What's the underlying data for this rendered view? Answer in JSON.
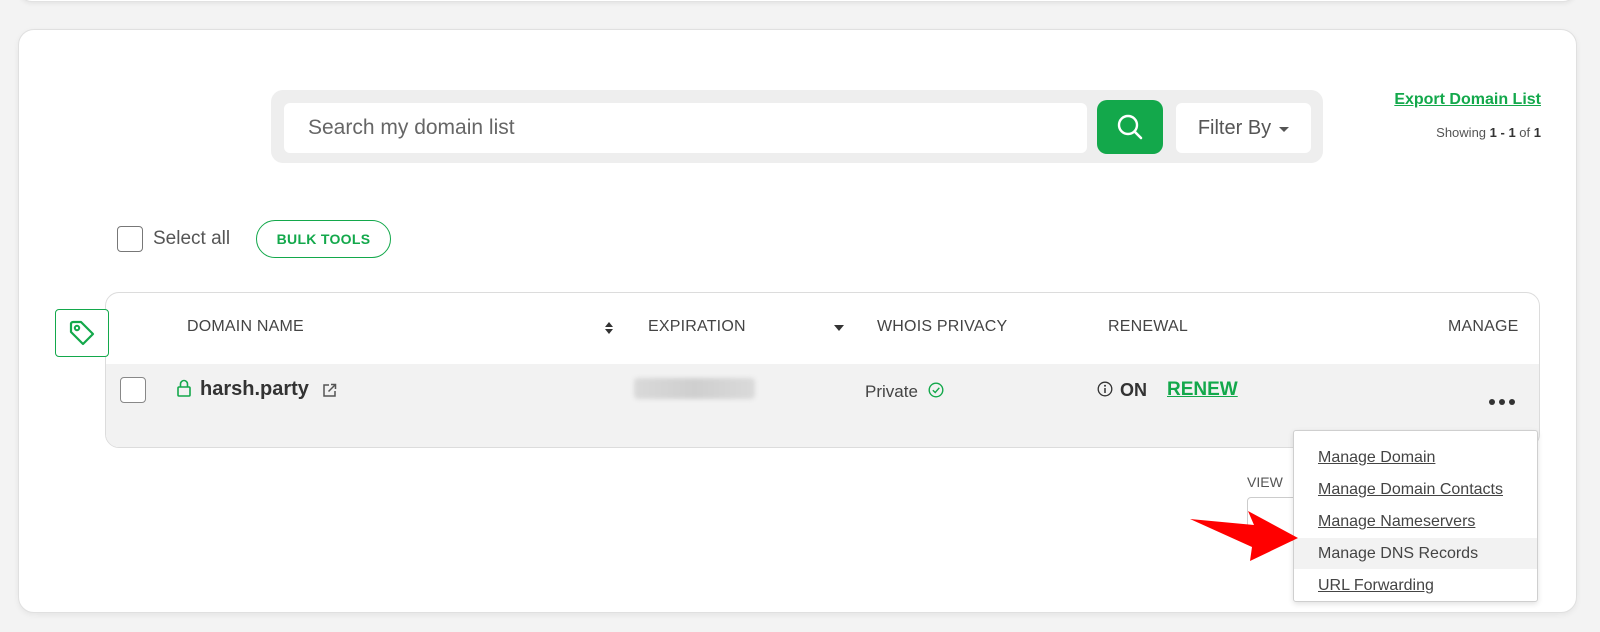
{
  "search": {
    "placeholder": "Search my domain list",
    "filter_label": "Filter By"
  },
  "header_links": {
    "export_label": "Export Domain List",
    "showing_prefix": "Showing",
    "showing_range": "1 - 1",
    "showing_of": "of",
    "showing_total": "1"
  },
  "bulk": {
    "select_all_label": "Select all",
    "bulk_tools_label": "BULK TOOLS"
  },
  "table": {
    "columns": [
      "DOMAIN NAME",
      "EXPIRATION",
      "WHOIS PRIVACY",
      "RENEWAL",
      "MANAGE"
    ],
    "rows": [
      {
        "domain": "harsh.party",
        "whois": "Private",
        "renewal_status": "ON",
        "renew_label": "RENEW"
      }
    ]
  },
  "view": {
    "label": "VIEW"
  },
  "manage_menu": {
    "items": [
      "Manage Domain",
      "Manage Domain Contacts",
      "Manage Nameservers",
      "Manage DNS Records",
      "URL Forwarding"
    ],
    "highlighted": "Manage DNS Records"
  },
  "colors": {
    "accent": "#13a84b",
    "arrow": "#ff0000",
    "row_bg": "#f2f2f2"
  },
  "icons": [
    "search-icon",
    "caret-down-icon",
    "tag-icon",
    "sort-both-icon",
    "sort-down-icon",
    "lock-icon",
    "external-link-icon",
    "check-circle-icon",
    "info-icon",
    "more-icon",
    "annotation-arrow"
  ]
}
